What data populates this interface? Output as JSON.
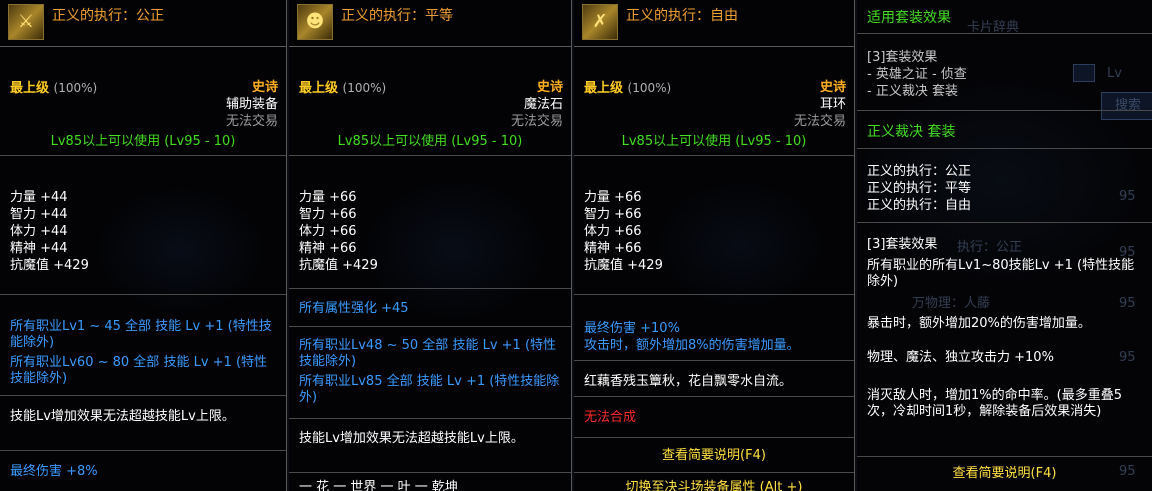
{
  "p1": {
    "title": "正义的执行：公正",
    "grade": "最上级",
    "grade_pct": "(100%)",
    "rarity": "史诗",
    "slot": "辅助装备",
    "trade": "无法交易",
    "req": "Lv85以上可以使用 (Lv95 - 10)",
    "stats": [
      "力量 +44",
      "智力 +44",
      "体力 +44",
      "精神 +44",
      "抗魔值 +429"
    ],
    "skill_a": "所有职业Lv1 ~ 45 全部 技能 Lv +1 (特性技能除外)",
    "skill_b": "所有职业Lv60 ~ 80 全部 技能 Lv +1 (特性技能除外)",
    "limit": "技能Lv增加效果无法超越技能Lv上限。",
    "final": "最终伤害 +8%"
  },
  "p2": {
    "title": "正义的执行：平等",
    "grade": "最上级",
    "grade_pct": "(100%)",
    "rarity": "史诗",
    "slot": "魔法石",
    "trade": "无法交易",
    "req": "Lv85以上可以使用 (Lv95 - 10)",
    "stats": [
      "力量 +66",
      "智力 +66",
      "体力 +66",
      "精神 +66",
      "抗魔值 +429"
    ],
    "attr": "所有属性强化 +45",
    "skill_a": "所有职业Lv48 ~ 50 全部 技能 Lv +1 (特性技能除外)",
    "skill_b": "所有职业Lv85 全部 技能 Lv +1 (特性技能除外)",
    "limit": "技能Lv增加效果无法超越技能Lv上限。",
    "bottom": "一 花 一 世界 一 叶 一 乾坤"
  },
  "p3": {
    "title": "正义的执行：自由",
    "grade": "最上级",
    "grade_pct": "(100%)",
    "rarity": "史诗",
    "slot": "耳环",
    "trade": "无法交易",
    "req": "Lv85以上可以使用 (Lv95 - 10)",
    "stats": [
      "力量 +66",
      "智力 +66",
      "体力 +66",
      "精神 +66",
      "抗魔值 +429"
    ],
    "final": "最终伤害 +10%",
    "crit": "攻击时，额外增加8%的伤害增加量。",
    "flavor": "红藕香残玉簟秋，花自飘零水自流。",
    "nosynth": "无法合成",
    "view": "查看简要说明(F4)",
    "bottom": "切换至决斗场装备属性 (Alt +)"
  },
  "p4": {
    "header": "适用套装效果",
    "s3_title": "[3]套装效果",
    "s3_lines": [
      "- 英雄之证 - 侦查",
      "- 正义裁决 套装"
    ],
    "set_name": "正义裁决 套装",
    "members": [
      "正义的执行：公正",
      "正义的执行：平等",
      "正义的执行：自由"
    ],
    "s3b_title": "[3]套装效果",
    "eff1": "所有职业的所有Lv1~80技能Lv +1 (特性技能除外)",
    "eff2": "暴击时，额外增加20%的伤害增加量。",
    "eff3": "物理、魔法、独立攻击力 +10%",
    "eff4": "消灭敌人时，增加1%的命中率。(最多重叠5次，冷却时间1秒，解除装备后效果消失)",
    "view": "查看简要说明(F4)",
    "ghost_title": "卡片辞典",
    "ghost_search": "搜索",
    "ghost_lv": "Lv",
    "ghost_name_a": "执行：公正",
    "ghost_name_b": "万物理：人藤",
    "ghost_nums": [
      "95",
      "95",
      "95",
      "95",
      "95"
    ]
  },
  "colors": {
    "title": "#f0a030",
    "epic": "#ffb020",
    "grade": "#ffcc22",
    "req": "#44dd22",
    "skill": "#3a9bff",
    "warn": "#ff2a2a",
    "set_green": "#44dd22",
    "view_yellow": "#ffe040"
  },
  "icons": [
    "gold-sword-icon",
    "gold-mask-icon",
    "gold-crossed-sword-icon"
  ]
}
